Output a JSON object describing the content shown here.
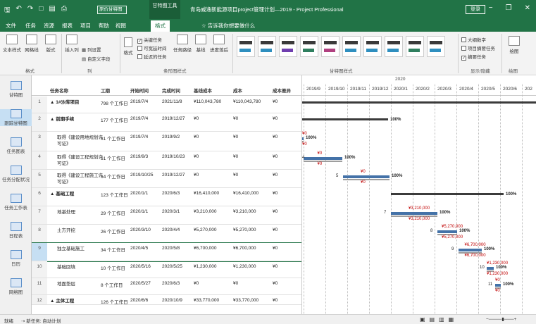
{
  "title": {
    "view_selector": "原价甘特图",
    "context_tab": "甘特图工具",
    "document": "青岛威逸新能源项目project管理计划—2019 - Project Professional",
    "login": "登录",
    "qat_icons": [
      "save-icon",
      "undo-icon",
      "redo-icon",
      "new-icon",
      "open-icon",
      "print-icon",
      "gantt-view-icon"
    ]
  },
  "tabs": [
    "文件",
    "任务",
    "资源",
    "报表",
    "项目",
    "帮助",
    "视图",
    "格式"
  ],
  "active_tab": "格式",
  "tellme": "告诉我你想要做什么",
  "ribbon": {
    "format_group": {
      "buttons": [
        "文本样式",
        "网格线",
        "版式"
      ],
      "label": "格式"
    },
    "columns_group": {
      "insert": "插入列",
      "settings": "列设置",
      "custom": "自定义字段",
      "label": "列"
    },
    "bar_styles": {
      "format": "格式",
      "checks": [
        {
          "label": "关键任务",
          "checked": true
        },
        {
          "label": "可宽延时间",
          "checked": false
        },
        {
          "label": "延迟的任务",
          "checked": false
        }
      ],
      "buttons": [
        "任务路径",
        "基线",
        "进度落后"
      ],
      "label": "条形图样式"
    },
    "gantt_styles_label": "甘特图样式",
    "show_hide": {
      "checks": [
        {
          "label": "大纲数字",
          "checked": false
        },
        {
          "label": "项目摘要任务",
          "checked": false
        },
        {
          "label": "摘要任务",
          "checked": true
        }
      ],
      "label": "显示/隐藏"
    },
    "drawing": {
      "button": "绘图",
      "label": "绘图"
    }
  },
  "views": [
    {
      "label": "甘特图",
      "selected": false
    },
    {
      "label": "跟踪甘特图",
      "selected": true
    },
    {
      "label": "任务图表",
      "selected": false
    },
    {
      "label": "任务分配状况",
      "selected": false
    },
    {
      "label": "任务工作表",
      "selected": false
    },
    {
      "label": "日程表",
      "selected": false
    },
    {
      "label": "日历",
      "selected": false
    },
    {
      "label": "网络图",
      "selected": false
    }
  ],
  "table": {
    "headers": [
      "任务名称",
      "工期",
      "开始时间",
      "完成时间",
      "基线成本",
      "成本",
      "成本差异"
    ],
    "rows": [
      {
        "id": "1",
        "name": "▲ 1#沙库项目",
        "duration": "798 个工作日",
        "start": "2019/7/4",
        "finish": "2021/11/8",
        "baseline": "¥110,043,780",
        "cost": "¥110,043,780",
        "variance": "¥0",
        "bold": true
      },
      {
        "id": "2",
        "name": "▲ 前期手续",
        "duration": "177 个工作日",
        "start": "2019/7/4",
        "finish": "2019/12/27",
        "baseline": "¥0",
        "cost": "¥0",
        "variance": "¥0",
        "bold": true
      },
      {
        "id": "3",
        "name": "取得《建设用地规划许可证》",
        "duration": "61 个工作日",
        "start": "2019/7/4",
        "finish": "2019/9/2",
        "baseline": "¥0",
        "cost": "¥0",
        "variance": "¥0",
        "bold": false
      },
      {
        "id": "4",
        "name": "取得《建设工程规划许可证》",
        "duration": "51 个工作日",
        "start": "2019/9/3",
        "finish": "2019/10/23",
        "baseline": "¥0",
        "cost": "¥0",
        "variance": "¥0",
        "bold": false
      },
      {
        "id": "5",
        "name": "取得《建设工程施工许可证》",
        "duration": "64 个工作日",
        "start": "2019/10/25",
        "finish": "2019/12/27",
        "baseline": "¥0",
        "cost": "¥0",
        "variance": "¥0",
        "bold": false
      },
      {
        "id": "6",
        "name": "▲ 基础工程",
        "duration": "123 个工作日",
        "start": "2020/1/1",
        "finish": "2020/6/3",
        "baseline": "¥16,410,000",
        "cost": "¥16,410,000",
        "variance": "¥0",
        "bold": true
      },
      {
        "id": "7",
        "name": "地基处理",
        "duration": "29 个工作日",
        "start": "2020/1/1",
        "finish": "2020/3/1",
        "baseline": "¥3,210,000",
        "cost": "¥3,210,000",
        "variance": "¥0",
        "bold": false
      },
      {
        "id": "8",
        "name": "土方开挖",
        "duration": "26 个工作日",
        "start": "2020/3/10",
        "finish": "2020/4/4",
        "baseline": "¥5,270,000",
        "cost": "¥5,270,000",
        "variance": "¥0",
        "bold": false
      },
      {
        "id": "9",
        "name": "独立基础施工",
        "duration": "34 个工作日",
        "start": "2020/4/5",
        "finish": "2020/5/8",
        "baseline": "¥6,700,000",
        "cost": "¥6,700,000",
        "variance": "¥0",
        "bold": false,
        "selected": true
      },
      {
        "id": "10",
        "name": "基础回填",
        "duration": "10 个工作日",
        "start": "2020/5/16",
        "finish": "2020/5/25",
        "baseline": "¥1,230,000",
        "cost": "¥1,230,000",
        "variance": "¥0",
        "bold": false
      },
      {
        "id": "11",
        "name": "地面垫层",
        "duration": "8 个工作日",
        "start": "2020/5/27",
        "finish": "2020/6/3",
        "baseline": "¥0",
        "cost": "¥0",
        "variance": "¥0",
        "bold": false
      },
      {
        "id": "12",
        "name": "▲ 主体工程",
        "duration": "126 个工作日",
        "start": "2020/6/6",
        "finish": "2020/10/9",
        "baseline": "¥33,770,000",
        "cost": "¥33,770,000",
        "variance": "¥0",
        "bold": true
      }
    ]
  },
  "gantt": {
    "year_label": "2020",
    "months": [
      "2019/9",
      "2019/10",
      "2019/11",
      "2019/12",
      "2020/1",
      "2020/2",
      "2020/3",
      "2020/4",
      "2020/5",
      "2020/6",
      "202"
    ],
    "labels": [
      {
        "row": 1,
        "pct": "100%"
      },
      {
        "row": 2,
        "pct": "100%",
        "top": "¥0",
        "bottom": "¥0"
      },
      {
        "row": 3,
        "pct": "100%",
        "top": "¥0",
        "bottom": "¥0",
        "num": "4"
      },
      {
        "row": 4,
        "pct": "100%",
        "top": "¥0",
        "bottom": "¥0",
        "num": "5"
      },
      {
        "row": 5,
        "pct": "100%"
      },
      {
        "row": 6,
        "pct": "100%",
        "top": "¥3,210,000",
        "bottom": "¥3,210,000",
        "num": "7"
      },
      {
        "row": 7,
        "pct": "100%",
        "top": "¥5,270,000",
        "bottom": "¥5,270,000",
        "num": "8"
      },
      {
        "row": 8,
        "pct": "100%",
        "top": "¥6,700,000",
        "bottom": "¥6,700,000",
        "num": "9"
      },
      {
        "row": 9,
        "pct": "100%",
        "top": "¥1,230,000",
        "bottom": "¥1,230,000",
        "num": "10"
      },
      {
        "row": 10,
        "pct": "100%",
        "top": "¥0",
        "bottom": "¥0",
        "num": "11"
      }
    ],
    "colors": {
      "summary": "#3b3b3b",
      "task": "#4472a8",
      "baseline": "#9e9e9e",
      "cost": "#c00000"
    }
  },
  "status": {
    "ready": "就绪",
    "new_tasks": "新任务: 自动计划"
  }
}
